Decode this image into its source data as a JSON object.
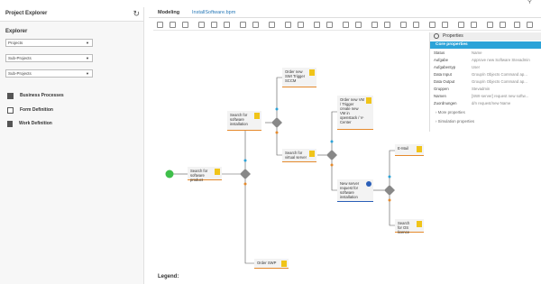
{
  "left": {
    "title": "Project Explorer",
    "explorer_label": "Explorer",
    "selects": [
      "Projects",
      "Sub-Projects",
      "Sub-Projects"
    ],
    "nav": [
      "Business Processes",
      "Form Definition",
      "Work Definition"
    ]
  },
  "main": {
    "tab_modeling": "Modeling",
    "tab_file": "InstallSoftware.bpm",
    "legend": "Legend:"
  },
  "nodes": {
    "search_product": "Search for software product",
    "search_installation": "Search for software installation",
    "order_swi": "Order new SWI Trigger SCCM",
    "order_vm": "Order new VM / Trigger create new VM in openstack / V-Center",
    "search_virtual": "Search for virtual server",
    "new_server": "New server request for software installation",
    "email": "E-Mail",
    "search_os": "Search for OS licence",
    "order_swp": "Order SWP"
  },
  "props": {
    "title": "Properties",
    "core": "Core properties",
    "rows": [
      {
        "k": "Status",
        "v": "Name"
      },
      {
        "k": "Aufgabe",
        "v": "Approve new Software Stevadmin"
      },
      {
        "k": "Aufgabentyp",
        "v": "User"
      },
      {
        "k": "Data Input",
        "v": "Group/n Objects Command ap..."
      },
      {
        "k": "Data Output",
        "v": "Group/n Objects Command ap..."
      },
      {
        "k": "Gruppen",
        "v": "Stevadmin"
      },
      {
        "k": "Namen",
        "v": "[SWI-server] request new softw..."
      },
      {
        "k": "Zuordnungen",
        "v": "d/n request/new Name"
      }
    ],
    "more": "More properties",
    "simulation": "Simulation properties"
  }
}
